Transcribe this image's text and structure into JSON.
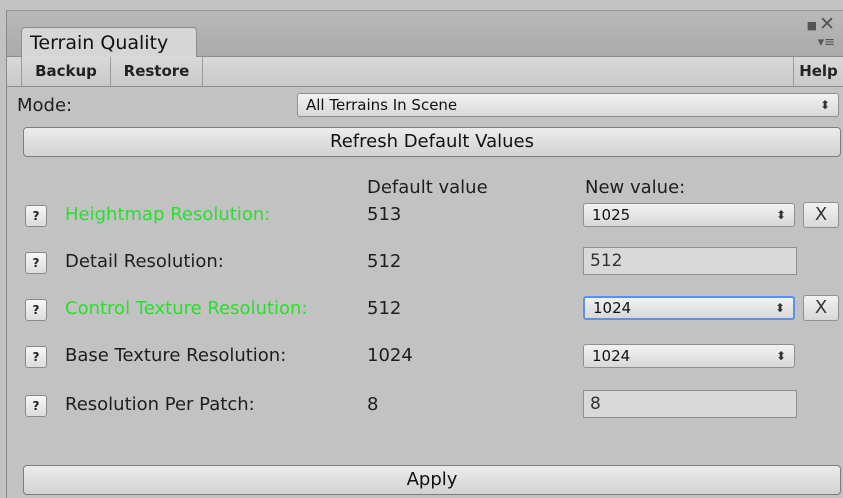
{
  "window": {
    "tab_title": "Terrain Quality",
    "max_icon": "■",
    "close_icon": "✕",
    "menu_icon": "▾≡"
  },
  "toolbar": {
    "backup_label": "Backup",
    "restore_label": "Restore",
    "help_label": "Help"
  },
  "mode": {
    "label": "Mode:",
    "selected": "All Terrains In Scene"
  },
  "refresh_label": "Refresh Default Values",
  "columns": {
    "default_header": "Default value",
    "new_header": "New value:"
  },
  "help_glyph": "?",
  "popup_arrows": "⬍",
  "reset_glyph": "X",
  "rows": [
    {
      "label": "Heightmap Resolution:",
      "default": "513",
      "new": "1025",
      "modified": true
    },
    {
      "label": "Detail Resolution:",
      "default": "512",
      "new": "512",
      "modified": false
    },
    {
      "label": "Control Texture Resolution:",
      "default": "512",
      "new": "1024",
      "modified": true
    },
    {
      "label": "Base Texture Resolution:",
      "default": "1024",
      "new": "1024",
      "modified": false
    },
    {
      "label": "Resolution Per Patch:",
      "default": "8",
      "new": "8",
      "modified": false
    }
  ],
  "apply_label": "Apply",
  "colors": {
    "modified_label": "#27df2c",
    "focus_ring": "#5b8ff0",
    "panel_bg": "#c2c2c2"
  }
}
